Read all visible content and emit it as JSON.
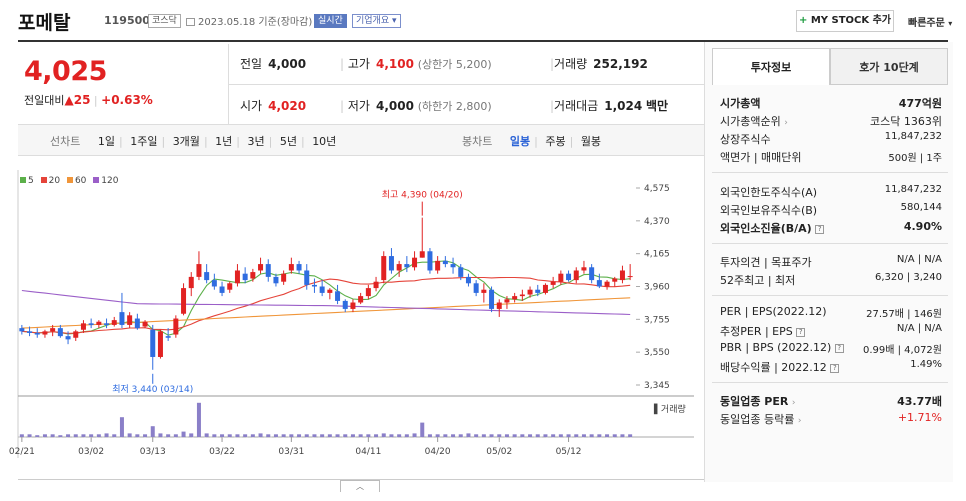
{
  "header": {
    "stock_name": "포메탈",
    "stock_code": "119500",
    "market_tag": "코스닥",
    "date_text": "2023.05.18 기준(장마감)",
    "realtime_tag": "실시간",
    "company_tag": "기업개요",
    "mystock_plus": "+",
    "mystock_label": "MY STOCK 추가",
    "quick_order": "빠른주문"
  },
  "price": {
    "current": "4,025",
    "change_label": "전일대비",
    "change_arrow": "▲",
    "change_value": "25",
    "change_pct": "+0.63%"
  },
  "info": {
    "prev_label": "전일",
    "prev_value": "4,000",
    "high_label": "고가",
    "high_value": "4,100",
    "upper_limit": "(상한가 5,200)",
    "volume_label": "거래량",
    "volume_value": "252,192",
    "open_label": "시가",
    "open_value": "4,020",
    "low_label": "저가",
    "low_value": "4,000",
    "lower_limit": "(하한가 2,800)",
    "amount_label": "거래대금",
    "amount_value": "1,024",
    "amount_unit": "백만"
  },
  "chart_tabs": {
    "line_label": "선차트",
    "periods": [
      "1일",
      "1주일",
      "3개월",
      "1년",
      "3년",
      "5년",
      "10년"
    ],
    "candle_label": "봉차트",
    "candles": [
      "일봉",
      "주봉",
      "월봉"
    ],
    "active_candle": "일봉"
  },
  "legend": [
    {
      "label": "5",
      "color": "#5cb04a"
    },
    {
      "label": "20",
      "color": "#e5443a"
    },
    {
      "label": "60",
      "color": "#f0963a"
    },
    {
      "label": "120",
      "color": "#9b5fc8"
    }
  ],
  "annotations": {
    "high": "최고 4,390 (04/20)",
    "low": "최저 3,440 (03/14)",
    "volume_label": "거래량"
  },
  "chart_data": {
    "type": "candlestick",
    "y_ticks": [
      4575,
      4370,
      4165,
      3960,
      3755,
      3550,
      3345
    ],
    "x_ticks": [
      "02/21",
      "03/02",
      "03/13",
      "03/22",
      "03/31",
      "04/11",
      "04/20",
      "05/02",
      "05/12"
    ],
    "ohlc": [
      [
        3700,
        3720,
        3660,
        3680
      ],
      [
        3680,
        3710,
        3650,
        3670
      ],
      [
        3670,
        3700,
        3640,
        3660
      ],
      [
        3660,
        3690,
        3640,
        3680
      ],
      [
        3680,
        3720,
        3650,
        3700
      ],
      [
        3700,
        3720,
        3640,
        3650
      ],
      [
        3650,
        3680,
        3600,
        3630
      ],
      [
        3640,
        3690,
        3620,
        3680
      ],
      [
        3690,
        3750,
        3670,
        3730
      ],
      [
        3730,
        3760,
        3700,
        3720
      ],
      [
        3720,
        3750,
        3700,
        3740
      ],
      [
        3730,
        3760,
        3700,
        3720
      ],
      [
        3720,
        3770,
        3710,
        3750
      ],
      [
        3800,
        3920,
        3700,
        3720
      ],
      [
        3720,
        3800,
        3700,
        3780
      ],
      [
        3760,
        3790,
        3690,
        3700
      ],
      [
        3710,
        3750,
        3700,
        3740
      ],
      [
        3690,
        3720,
        3440,
        3520
      ],
      [
        3520,
        3690,
        3510,
        3680
      ],
      [
        3650,
        3700,
        3620,
        3640
      ],
      [
        3660,
        3780,
        3640,
        3760
      ],
      [
        3790,
        3980,
        3780,
        3950
      ],
      [
        3950,
        4050,
        3900,
        4020
      ],
      [
        4020,
        4180,
        4000,
        4100
      ],
      [
        4050,
        4100,
        3980,
        4000
      ],
      [
        4000,
        4040,
        3940,
        3960
      ],
      [
        3960,
        3990,
        3900,
        3920
      ],
      [
        3940,
        3990,
        3920,
        3980
      ],
      [
        3980,
        4100,
        3960,
        4060
      ],
      [
        4040,
        4080,
        3980,
        4000
      ],
      [
        4010,
        4070,
        3990,
        4050
      ],
      [
        4060,
        4140,
        4040,
        4100
      ],
      [
        4100,
        4130,
        3990,
        4020
      ],
      [
        4020,
        4040,
        3960,
        3980
      ],
      [
        3990,
        4060,
        3970,
        4040
      ],
      [
        4060,
        4140,
        4040,
        4100
      ],
      [
        4100,
        4120,
        4040,
        4060
      ],
      [
        4060,
        4100,
        3940,
        3970
      ],
      [
        3970,
        4010,
        3920,
        3960
      ],
      [
        3960,
        4000,
        3900,
        3920
      ],
      [
        3920,
        3950,
        3880,
        3940
      ],
      [
        3930,
        3970,
        3850,
        3870
      ],
      [
        3870,
        3880,
        3800,
        3820
      ],
      [
        3820,
        3880,
        3800,
        3860
      ],
      [
        3860,
        3920,
        3850,
        3900
      ],
      [
        3900,
        3970,
        3880,
        3950
      ],
      [
        3950,
        4020,
        3930,
        3990
      ],
      [
        4000,
        4180,
        3980,
        4150
      ],
      [
        4150,
        4200,
        4040,
        4060
      ],
      [
        4060,
        4120,
        4020,
        4100
      ],
      [
        4100,
        4150,
        4050,
        4080
      ],
      [
        4080,
        4180,
        4060,
        4140
      ],
      [
        4140,
        4390,
        4140,
        4180
      ],
      [
        4180,
        4200,
        4040,
        4060
      ],
      [
        4060,
        4150,
        4040,
        4120
      ],
      [
        4120,
        4150,
        4080,
        4100
      ],
      [
        4100,
        4140,
        4040,
        4080
      ],
      [
        4080,
        4100,
        4000,
        4020
      ],
      [
        4020,
        4040,
        3960,
        3980
      ],
      [
        3980,
        4000,
        3900,
        3920
      ],
      [
        3920,
        3980,
        3860,
        3940
      ],
      [
        3940,
        3960,
        3800,
        3820
      ],
      [
        3820,
        3880,
        3770,
        3860
      ],
      [
        3860,
        3900,
        3820,
        3880
      ],
      [
        3880,
        3920,
        3860,
        3900
      ],
      [
        3900,
        3940,
        3870,
        3910
      ],
      [
        3910,
        3960,
        3890,
        3940
      ],
      [
        3940,
        3970,
        3900,
        3920
      ],
      [
        3920,
        3980,
        3910,
        3970
      ],
      [
        3970,
        4020,
        3950,
        3990
      ],
      [
        3990,
        4060,
        3970,
        4040
      ],
      [
        4040,
        4060,
        3990,
        4000
      ],
      [
        4000,
        4080,
        3980,
        4060
      ],
      [
        4060,
        4120,
        4040,
        4080
      ],
      [
        4080,
        4100,
        3980,
        4000
      ],
      [
        4000,
        4040,
        3950,
        3960
      ],
      [
        3960,
        4000,
        3940,
        3990
      ],
      [
        3990,
        4020,
        3960,
        4010
      ],
      [
        4000,
        4090,
        3980,
        4060
      ],
      [
        4020,
        4100,
        4000,
        4025
      ]
    ],
    "volume": [
      3,
      3,
      2,
      3,
      3,
      2,
      3,
      3,
      3,
      3,
      3,
      4,
      3,
      22,
      4,
      3,
      3,
      12,
      4,
      3,
      3,
      6,
      4,
      38,
      4,
      3,
      3,
      3,
      3,
      3,
      3,
      4,
      3,
      3,
      3,
      3,
      3,
      3,
      3,
      3,
      3,
      3,
      3,
      3,
      3,
      3,
      3,
      4,
      3,
      3,
      3,
      4,
      16,
      3,
      3,
      3,
      3,
      3,
      4,
      3,
      3,
      3,
      3,
      3,
      3,
      3,
      3,
      3,
      3,
      3,
      3,
      3,
      3,
      3,
      3,
      3,
      3,
      3,
      3,
      3
    ]
  },
  "side": {
    "tab_invest": "투자정보",
    "tab_quote": "호가 10단계",
    "mktcap_label": "시가총액",
    "mktcap_value": "477억원",
    "rank_label": "시가총액순위",
    "rank_value": "코스닥 1363위",
    "shares_label": "상장주식수",
    "shares_value": "11,847,232",
    "par_label": "액면가 | 매매단위",
    "par_value": "500원 | 1주",
    "foreign_limit_label": "외국인한도주식수(A)",
    "foreign_limit_value": "11,847,232",
    "foreign_hold_label": "외국인보유주식수(B)",
    "foreign_hold_value": "580,144",
    "foreign_ratio_label": "외국인소진율(B/A)",
    "foreign_ratio_value": "4.90%",
    "opinion_label": "투자의견 | 목표주가",
    "opinion_value": "N/A | N/A",
    "week52_label": "52주최고 | 최저",
    "week52_value": "6,320 | 3,240",
    "per_label": "PER | EPS(2022.12)",
    "per_value": "27.57배 | 146원",
    "est_per_label": "추정PER | EPS",
    "est_per_value": "N/A | N/A",
    "pbr_label": "PBR | BPS (2022.12)",
    "pbr_value": "0.99배 | 4,072원",
    "div_label": "배당수익률 | 2022.12",
    "div_value": "1.49%",
    "industry_per_label": "동일업종 PER",
    "industry_per_value": "43.77배",
    "industry_rate_label": "동일업종 등락률",
    "industry_rate_value": "+1.71%"
  }
}
